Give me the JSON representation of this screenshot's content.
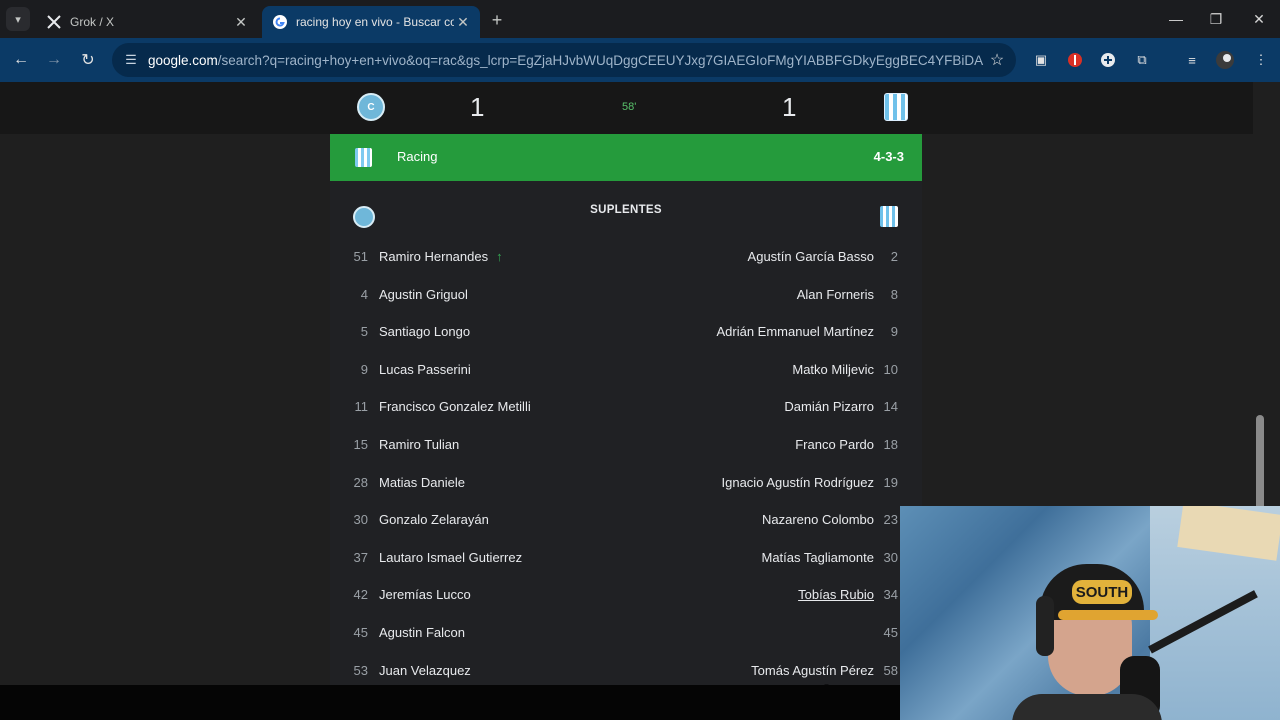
{
  "browser": {
    "tabs": [
      {
        "title": "Grok / X",
        "favicon": "x-logo-icon",
        "active": false
      },
      {
        "title": "racing hoy en vivo - Buscar con",
        "favicon": "google-logo-icon",
        "active": true
      }
    ],
    "url_host": "google.com",
    "url_rest": "/search?q=racing+hoy+en+vivo&oq=rac&gs_lcrp=EgZjaHJvbWUqDggCEEUYJxg7GIAEGIoFMgYIABBFGDkyEggBEC4YFBiDARiHA...",
    "accent_color": "#0b3a66"
  },
  "match": {
    "home_score": "1",
    "away_score": "1",
    "minute": "58'",
    "team_name": "Racing",
    "formation": "4-3-3",
    "subs_label": "SUPLENTES",
    "team_bar_color": "#259b3c",
    "subs": [
      {
        "home_num": "51",
        "home_name": "Ramiro Hernandes",
        "home_arrow": "↑",
        "away_name": "Agustín García Basso",
        "away_num": "2"
      },
      {
        "home_num": "4",
        "home_name": "Agustin Griguol",
        "home_arrow": "",
        "away_name": "Alan Forneris",
        "away_num": "8"
      },
      {
        "home_num": "5",
        "home_name": "Santiago Longo",
        "home_arrow": "",
        "away_name": "Adrián Emmanuel Martínez",
        "away_num": "9"
      },
      {
        "home_num": "9",
        "home_name": "Lucas Passerini",
        "home_arrow": "",
        "away_name": "Matko Miljevic",
        "away_num": "10"
      },
      {
        "home_num": "11",
        "home_name": "Francisco Gonzalez Metilli",
        "home_arrow": "",
        "away_name": "Damián Pizarro",
        "away_num": "14"
      },
      {
        "home_num": "15",
        "home_name": "Ramiro Tulian",
        "home_arrow": "",
        "away_name": "Franco Pardo",
        "away_num": "18"
      },
      {
        "home_num": "28",
        "home_name": "Matias Daniele",
        "home_arrow": "",
        "away_name": "Ignacio Agustín Rodríguez",
        "away_num": "19"
      },
      {
        "home_num": "30",
        "home_name": "Gonzalo Zelarayán",
        "home_arrow": "",
        "away_name": "Nazareno Colombo",
        "away_num": "23"
      },
      {
        "home_num": "37",
        "home_name": "Lautaro Ismael Gutierrez",
        "home_arrow": "",
        "away_name": "Matías Tagliamonte",
        "away_num": "30"
      },
      {
        "home_num": "42",
        "home_name": "Jeremías Lucco",
        "home_arrow": "",
        "away_name": "Tobías Rubio",
        "away_num": "34"
      },
      {
        "home_num": "45",
        "home_name": "Agustin Falcon",
        "home_arrow": "",
        "away_name": "",
        "away_num": "45"
      },
      {
        "home_num": "53",
        "home_name": "Juan Velazquez",
        "home_arrow": "",
        "away_name": "Tomás Agustín Pérez",
        "away_num": "58"
      }
    ]
  },
  "webcam": {
    "cap_text": "SOUTH"
  }
}
